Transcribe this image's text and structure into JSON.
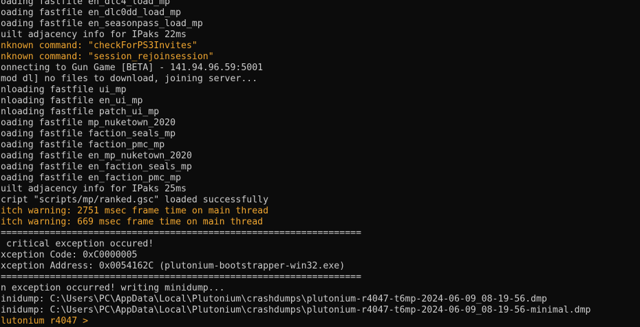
{
  "console": {
    "colors": {
      "background": "#0c0c0c",
      "text": "#cccccc",
      "warning": "#f0a630"
    },
    "lines": [
      {
        "text": "oading fastfile en_dlc4_load_mp",
        "kind": "normal"
      },
      {
        "text": "oading fastfile en_dlc0dd_load_mp",
        "kind": "normal"
      },
      {
        "text": "oading fastfile en_seasonpass_load_mp",
        "kind": "normal"
      },
      {
        "text": "uilt adjacency info for IPaks 22ms",
        "kind": "normal"
      },
      {
        "text": "nknown command: \"checkForPS3Invites\"",
        "kind": "warn"
      },
      {
        "text": "nknown command: \"session_rejoinsession\"",
        "kind": "warn"
      },
      {
        "text": "onnecting to Gun Game [BETA] - 141.94.96.59:5001",
        "kind": "normal"
      },
      {
        "text": "mod dl] no files to download, joining server...",
        "kind": "normal"
      },
      {
        "text": "nloading fastfile ui_mp",
        "kind": "normal"
      },
      {
        "text": "nloading fastfile en_ui_mp",
        "kind": "normal"
      },
      {
        "text": "nloading fastfile patch_ui_mp",
        "kind": "normal"
      },
      {
        "text": "oading fastfile mp_nuketown_2020",
        "kind": "normal"
      },
      {
        "text": "oading fastfile faction_seals_mp",
        "kind": "normal"
      },
      {
        "text": "oading fastfile faction_pmc_mp",
        "kind": "normal"
      },
      {
        "text": "oading fastfile en_mp_nuketown_2020",
        "kind": "normal"
      },
      {
        "text": "oading fastfile en_faction_seals_mp",
        "kind": "normal"
      },
      {
        "text": "oading fastfile en_faction_pmc_mp",
        "kind": "normal"
      },
      {
        "text": "uilt adjacency info for IPaks 25ms",
        "kind": "normal"
      },
      {
        "text": "cript \"scripts/mp/ranked.gsc\" loaded successfully",
        "kind": "normal"
      },
      {
        "text": "itch warning: 2751 msec frame time on main thread",
        "kind": "warn"
      },
      {
        "text": "itch warning: 669 msec frame time on main thread",
        "kind": "warn"
      },
      {
        "text": "==================================================================",
        "kind": "normal"
      },
      {
        "text": " critical exception occured!",
        "kind": "normal"
      },
      {
        "text": "xception Code: 0xC0000005",
        "kind": "normal"
      },
      {
        "text": "xception Address: 0x0054162C (plutonium-bootstrapper-win32.exe)",
        "kind": "normal"
      },
      {
        "text": "==================================================================",
        "kind": "normal"
      },
      {
        "text": "n exception occurred! writing minidump...",
        "kind": "normal"
      },
      {
        "text": "inidump: C:\\Users\\PC\\AppData\\Local\\Plutonium\\crashdumps\\plutonium-r4047-t6mp-2024-06-09_08-19-56.dmp",
        "kind": "normal"
      },
      {
        "text": "inidump: C:\\Users\\PC\\AppData\\Local\\Plutonium\\crashdumps\\plutonium-r4047-t6mp-2024-06-09_08-19-56-minimal.dmp",
        "kind": "normal"
      }
    ],
    "prompt": {
      "label": "lutonium r4047 > ",
      "value": ""
    }
  }
}
